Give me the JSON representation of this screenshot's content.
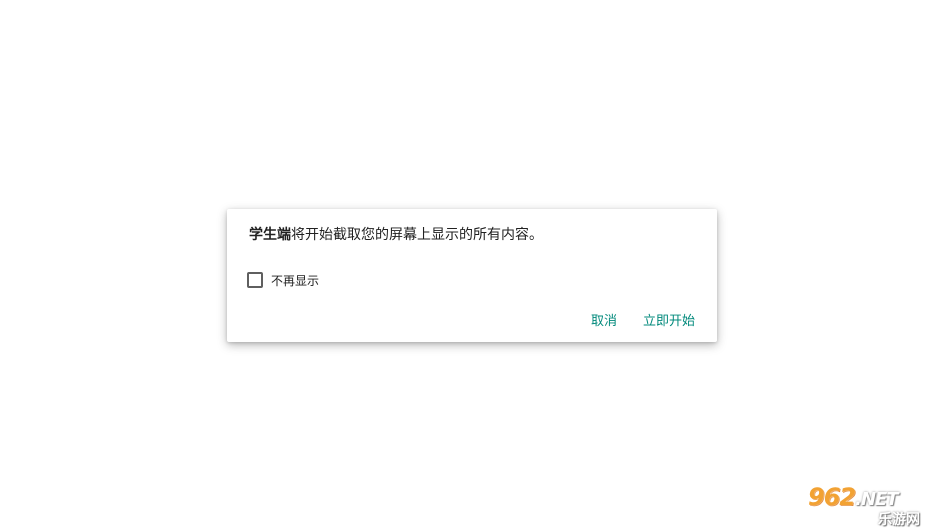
{
  "dialog": {
    "app_name": "学生端",
    "message_rest": "将开始截取您的屏幕上显示的所有内容。",
    "checkbox": {
      "label": "不再显示",
      "checked": false
    },
    "buttons": {
      "cancel_label": "取消",
      "start_label": "立即开始"
    },
    "accent_color": "#00897b"
  },
  "watermark": {
    "number": "962",
    "domain_suffix": ".NET",
    "site_name": "乐游网"
  }
}
